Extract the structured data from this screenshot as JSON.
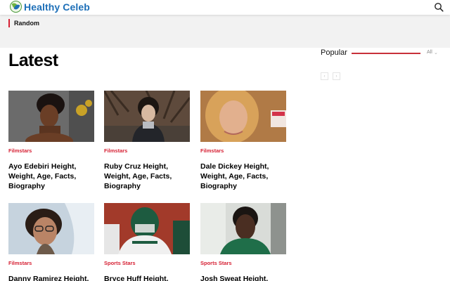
{
  "header": {
    "logo_text": "Healthy Celeb",
    "search_icon": "search-icon"
  },
  "nav": {
    "random_label": "Random"
  },
  "latest": {
    "heading": "Latest",
    "cards": [
      {
        "category": "Filmstars",
        "title": "Ayo Edebiri Height, Weight, Age, Facts, Biography"
      },
      {
        "category": "Filmstars",
        "title": "Ruby Cruz Height, Weight, Age, Facts, Biography"
      },
      {
        "category": "Filmstars",
        "title": "Dale Dickey Height, Weight, Age, Facts, Biography"
      },
      {
        "category": "Filmstars",
        "title": "Danny Ramirez Height,"
      },
      {
        "category": "Sports Stars",
        "title": "Bryce Huff Height, Weight,"
      },
      {
        "category": "Sports Stars",
        "title": "Josh Sweat Height,"
      }
    ]
  },
  "popular": {
    "heading": "Popular",
    "filter_label": "All",
    "prev_icon": "chevron-left-icon",
    "next_icon": "chevron-right-icon"
  },
  "colors": {
    "accent": "#d62134",
    "brand": "#1d6fb8"
  }
}
